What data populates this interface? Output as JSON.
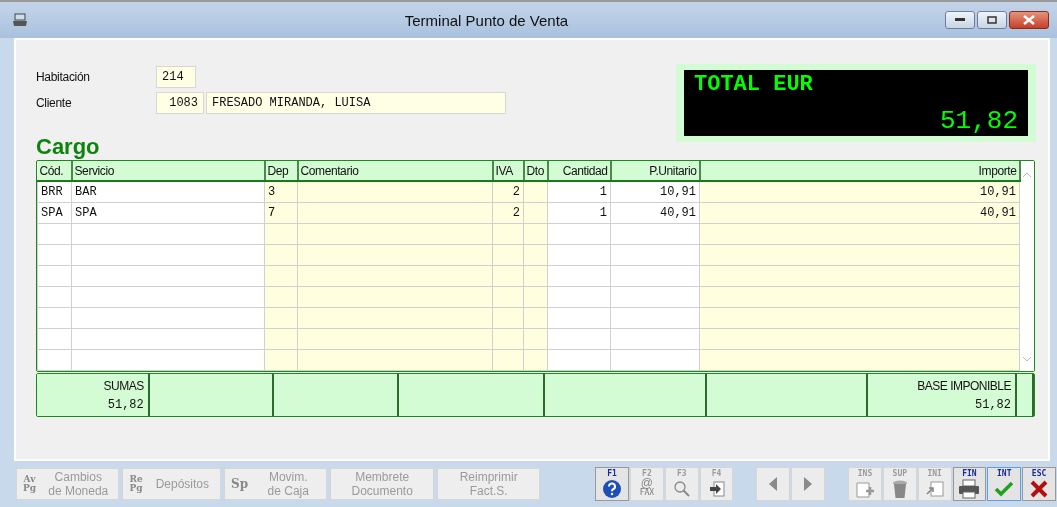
{
  "window": {
    "title": "Terminal Punto de Venta"
  },
  "form": {
    "habitacion_label": "Habitación",
    "habitacion": "214",
    "cliente_label": "Cliente",
    "cliente_code": "1083",
    "cliente_name": "FRESADO MIRANDA, LUISA"
  },
  "total": {
    "label": "TOTAL EUR",
    "amount": "51,82"
  },
  "section_title": "Cargo",
  "table": {
    "columns": [
      "Cód.",
      "Servicio",
      "Dep",
      "Comentario",
      "IVA",
      "Dto",
      "Cantidad",
      "P.Unitario",
      "Importe"
    ],
    "rows": [
      [
        "BRR",
        "BAR",
        "3",
        "",
        "2",
        "",
        "1",
        "10,91",
        "10,91"
      ],
      [
        "SPA",
        "SPA",
        "7",
        "",
        "2",
        "",
        "1",
        "40,91",
        "40,91"
      ]
    ]
  },
  "totals_row": {
    "sumas_label": "SUMAS",
    "sumas": "51,82",
    "base_label": "BASE IMPONIBLE",
    "base": "51,82"
  },
  "left_buttons": [
    {
      "key": [
        "Av",
        "Pg"
      ],
      "label": [
        "Cambios",
        "de Moneda"
      ],
      "disabled": true
    },
    {
      "key": [
        "Re",
        "Pg"
      ],
      "label": [
        "Depósitos"
      ],
      "disabled": true
    },
    {
      "key": [
        "Sp"
      ],
      "label": [
        "Movim.",
        "de Caja"
      ],
      "disabled": true
    },
    {
      "label": [
        "Membrete",
        "Documento"
      ],
      "disabled": true
    },
    {
      "label": [
        "Reimprimir",
        "Fact.S."
      ],
      "disabled": true
    }
  ],
  "function_keys": [
    {
      "kind": "help",
      "key": "F1",
      "disabled": false
    },
    {
      "kind": "fax",
      "key": "F2",
      "symbol": "@",
      "caption": "FAX",
      "disabled": true
    },
    {
      "kind": "search",
      "key": "F3",
      "disabled": true
    },
    {
      "kind": "exit",
      "key": "F4",
      "disabled": true
    },
    {
      "kind": "prev",
      "disabled": true
    },
    {
      "kind": "next",
      "disabled": true
    },
    {
      "kind": "insert",
      "key": "INS",
      "disabled": true
    },
    {
      "kind": "delete",
      "key": "SUP",
      "disabled": true
    },
    {
      "kind": "start",
      "key": "INI",
      "disabled": true
    },
    {
      "kind": "print",
      "key": "FIN",
      "disabled": false
    },
    {
      "kind": "ok",
      "key": "INT",
      "disabled": false,
      "selected": true
    },
    {
      "kind": "cancel",
      "key": "ESC",
      "disabled": false,
      "selected": false
    }
  ]
}
